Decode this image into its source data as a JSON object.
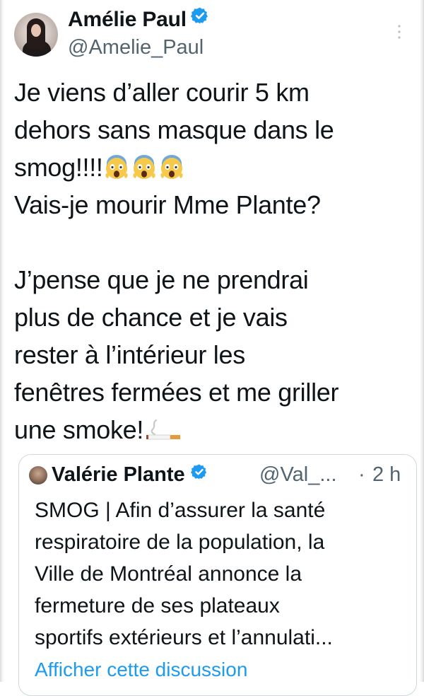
{
  "tweet": {
    "author": {
      "display_name": "Amélie Paul",
      "handle": "@Amelie_Paul",
      "verified": true
    },
    "more_icon": "more-vertical-icon",
    "text_lines": [
      "Je viens d’aller courir 5 km",
      "dehors sans masque dans le",
      "smog!!!!",
      "Vais-je mourir Mme Plante?",
      "",
      "J’pense que je ne prendrai",
      "plus de chance et je vais",
      "rester à l’intérieur les",
      "fenêtres fermées et me griller",
      "une smoke!"
    ],
    "emojis": [
      "screaming-face",
      "screaming-face",
      "screaming-face"
    ],
    "trailing_emoji": "cigarette"
  },
  "quoted_tweet": {
    "author": {
      "display_name": "Valérie Plante",
      "handle": "@Val_...",
      "verified": true
    },
    "separator": "·",
    "time": "2 h",
    "text_lines": [
      "SMOG | Afin d’assurer la santé",
      "respiratoire de la population, la",
      "Ville de Montréal annonce la",
      "fermeture de ses plateaux",
      "sportifs extérieurs et l’annulati..."
    ],
    "show_thread_link": "Afficher cette discussion"
  },
  "colors": {
    "text": "#0f1419",
    "secondary": "#536471",
    "link": "#1d9bf0",
    "verified": "#1d9bf0",
    "border": "#cfd9de"
  }
}
